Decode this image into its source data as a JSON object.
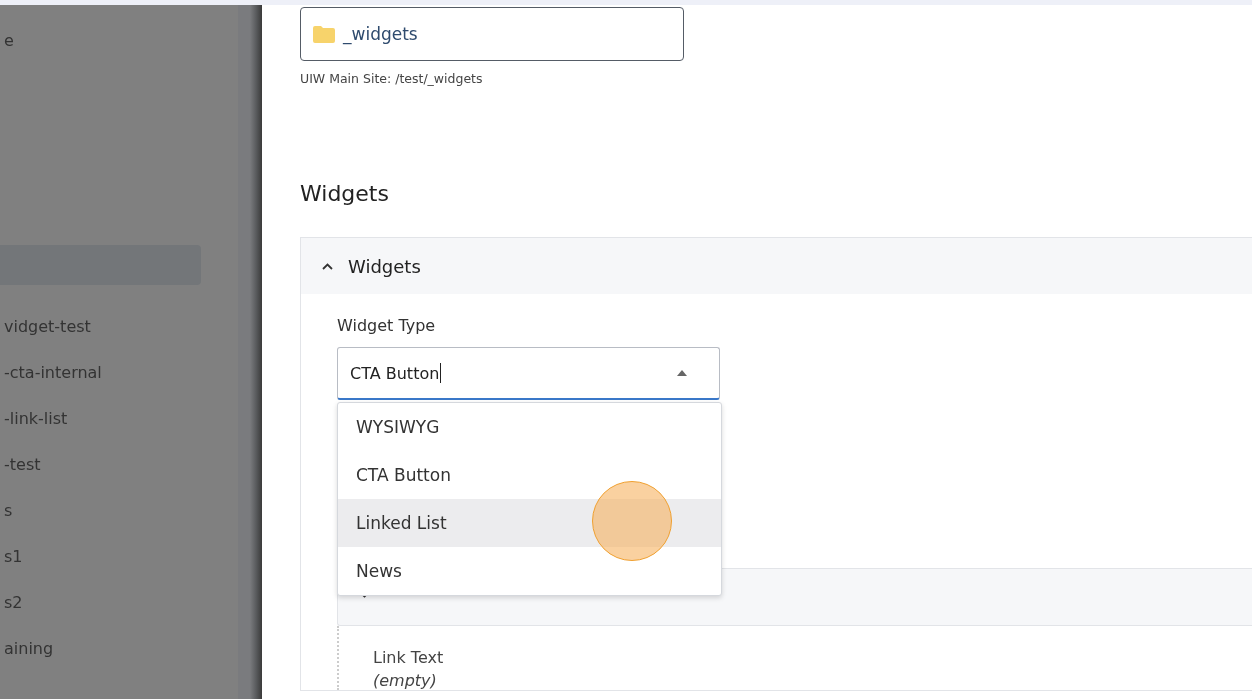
{
  "sidebar": {
    "items": [
      {
        "label": "e",
        "selected": false
      },
      {
        "selected": true
      },
      {
        "label": "vidget-test",
        "selected": false
      },
      {
        "label": "-cta-internal",
        "selected": false
      },
      {
        "label": "-link-list",
        "selected": false
      },
      {
        "label": "-test",
        "selected": false
      },
      {
        "label": "s",
        "selected": false
      },
      {
        "label": "s1",
        "selected": false
      },
      {
        "label": "s2",
        "selected": false
      },
      {
        "label": "aining",
        "selected": false
      }
    ]
  },
  "folder_field": {
    "value": "_widgets",
    "path": "UIW Main Site: /test/_widgets"
  },
  "heading": "Widgets",
  "panel": {
    "title": "Widgets",
    "expanded": true,
    "widget_type": {
      "label": "Widget Type",
      "value": "CTA Button",
      "open": true,
      "options": [
        {
          "label": "WYSIWYG",
          "highlighted": false
        },
        {
          "label": "CTA Button",
          "highlighted": false
        },
        {
          "label": "Linked List",
          "highlighted": true
        },
        {
          "label": "News",
          "highlighted": false
        }
      ]
    },
    "subpanel": {
      "expanded": false,
      "field_label": "Link Text",
      "field_value": "(empty)"
    }
  }
}
